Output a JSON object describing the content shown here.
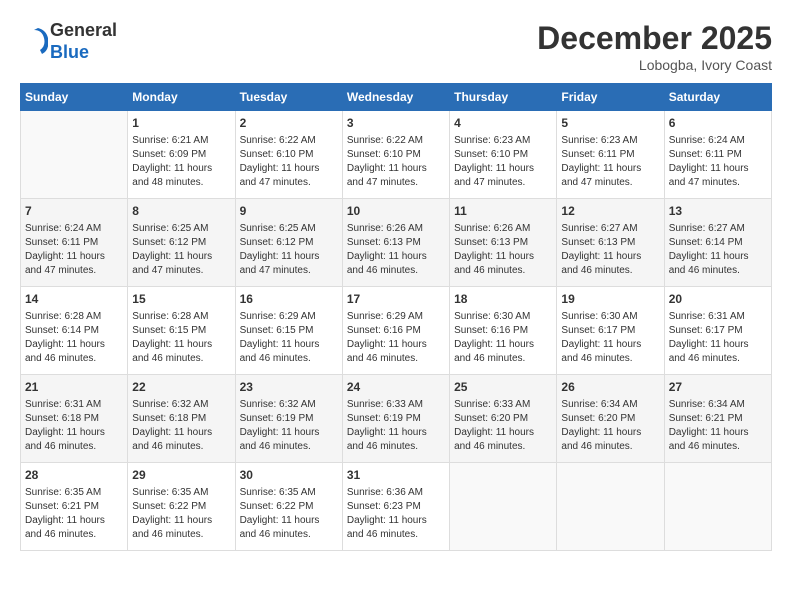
{
  "header": {
    "logo_line1": "General",
    "logo_line2": "Blue",
    "month_year": "December 2025",
    "location": "Lobogba, Ivory Coast"
  },
  "days_of_week": [
    "Sunday",
    "Monday",
    "Tuesday",
    "Wednesday",
    "Thursday",
    "Friday",
    "Saturday"
  ],
  "weeks": [
    [
      {
        "day": "",
        "info": ""
      },
      {
        "day": "1",
        "info": "Sunrise: 6:21 AM\nSunset: 6:09 PM\nDaylight: 11 hours\nand 48 minutes."
      },
      {
        "day": "2",
        "info": "Sunrise: 6:22 AM\nSunset: 6:10 PM\nDaylight: 11 hours\nand 47 minutes."
      },
      {
        "day": "3",
        "info": "Sunrise: 6:22 AM\nSunset: 6:10 PM\nDaylight: 11 hours\nand 47 minutes."
      },
      {
        "day": "4",
        "info": "Sunrise: 6:23 AM\nSunset: 6:10 PM\nDaylight: 11 hours\nand 47 minutes."
      },
      {
        "day": "5",
        "info": "Sunrise: 6:23 AM\nSunset: 6:11 PM\nDaylight: 11 hours\nand 47 minutes."
      },
      {
        "day": "6",
        "info": "Sunrise: 6:24 AM\nSunset: 6:11 PM\nDaylight: 11 hours\nand 47 minutes."
      }
    ],
    [
      {
        "day": "7",
        "info": "Sunrise: 6:24 AM\nSunset: 6:11 PM\nDaylight: 11 hours\nand 47 minutes."
      },
      {
        "day": "8",
        "info": "Sunrise: 6:25 AM\nSunset: 6:12 PM\nDaylight: 11 hours\nand 47 minutes."
      },
      {
        "day": "9",
        "info": "Sunrise: 6:25 AM\nSunset: 6:12 PM\nDaylight: 11 hours\nand 47 minutes."
      },
      {
        "day": "10",
        "info": "Sunrise: 6:26 AM\nSunset: 6:13 PM\nDaylight: 11 hours\nand 46 minutes."
      },
      {
        "day": "11",
        "info": "Sunrise: 6:26 AM\nSunset: 6:13 PM\nDaylight: 11 hours\nand 46 minutes."
      },
      {
        "day": "12",
        "info": "Sunrise: 6:27 AM\nSunset: 6:13 PM\nDaylight: 11 hours\nand 46 minutes."
      },
      {
        "day": "13",
        "info": "Sunrise: 6:27 AM\nSunset: 6:14 PM\nDaylight: 11 hours\nand 46 minutes."
      }
    ],
    [
      {
        "day": "14",
        "info": "Sunrise: 6:28 AM\nSunset: 6:14 PM\nDaylight: 11 hours\nand 46 minutes."
      },
      {
        "day": "15",
        "info": "Sunrise: 6:28 AM\nSunset: 6:15 PM\nDaylight: 11 hours\nand 46 minutes."
      },
      {
        "day": "16",
        "info": "Sunrise: 6:29 AM\nSunset: 6:15 PM\nDaylight: 11 hours\nand 46 minutes."
      },
      {
        "day": "17",
        "info": "Sunrise: 6:29 AM\nSunset: 6:16 PM\nDaylight: 11 hours\nand 46 minutes."
      },
      {
        "day": "18",
        "info": "Sunrise: 6:30 AM\nSunset: 6:16 PM\nDaylight: 11 hours\nand 46 minutes."
      },
      {
        "day": "19",
        "info": "Sunrise: 6:30 AM\nSunset: 6:17 PM\nDaylight: 11 hours\nand 46 minutes."
      },
      {
        "day": "20",
        "info": "Sunrise: 6:31 AM\nSunset: 6:17 PM\nDaylight: 11 hours\nand 46 minutes."
      }
    ],
    [
      {
        "day": "21",
        "info": "Sunrise: 6:31 AM\nSunset: 6:18 PM\nDaylight: 11 hours\nand 46 minutes."
      },
      {
        "day": "22",
        "info": "Sunrise: 6:32 AM\nSunset: 6:18 PM\nDaylight: 11 hours\nand 46 minutes."
      },
      {
        "day": "23",
        "info": "Sunrise: 6:32 AM\nSunset: 6:19 PM\nDaylight: 11 hours\nand 46 minutes."
      },
      {
        "day": "24",
        "info": "Sunrise: 6:33 AM\nSunset: 6:19 PM\nDaylight: 11 hours\nand 46 minutes."
      },
      {
        "day": "25",
        "info": "Sunrise: 6:33 AM\nSunset: 6:20 PM\nDaylight: 11 hours\nand 46 minutes."
      },
      {
        "day": "26",
        "info": "Sunrise: 6:34 AM\nSunset: 6:20 PM\nDaylight: 11 hours\nand 46 minutes."
      },
      {
        "day": "27",
        "info": "Sunrise: 6:34 AM\nSunset: 6:21 PM\nDaylight: 11 hours\nand 46 minutes."
      }
    ],
    [
      {
        "day": "28",
        "info": "Sunrise: 6:35 AM\nSunset: 6:21 PM\nDaylight: 11 hours\nand 46 minutes."
      },
      {
        "day": "29",
        "info": "Sunrise: 6:35 AM\nSunset: 6:22 PM\nDaylight: 11 hours\nand 46 minutes."
      },
      {
        "day": "30",
        "info": "Sunrise: 6:35 AM\nSunset: 6:22 PM\nDaylight: 11 hours\nand 46 minutes."
      },
      {
        "day": "31",
        "info": "Sunrise: 6:36 AM\nSunset: 6:23 PM\nDaylight: 11 hours\nand 46 minutes."
      },
      {
        "day": "",
        "info": ""
      },
      {
        "day": "",
        "info": ""
      },
      {
        "day": "",
        "info": ""
      }
    ]
  ]
}
